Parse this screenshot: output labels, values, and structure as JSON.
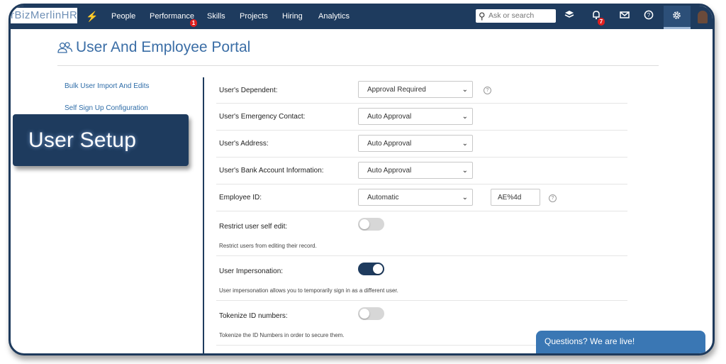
{
  "nav": {
    "logo": "rBizMerlinHR",
    "items": [
      "People",
      "Performance",
      "Skills",
      "Projects",
      "Hiring",
      "Analytics"
    ],
    "performance_badge": "1",
    "search_placeholder": "Ask or search",
    "notification_badge": "7",
    "icons": [
      "bolt-icon",
      "search-icon",
      "layers-icon",
      "bell-icon",
      "mail-icon",
      "help-icon",
      "gear-icon",
      "avatar"
    ]
  },
  "page": {
    "title": "User And Employee Portal"
  },
  "sidebar": {
    "links": [
      "Bulk User Import And Edits",
      "Self Sign Up Configuration"
    ],
    "callout": "User Setup"
  },
  "settings": {
    "dependent": {
      "label": "User's Dependent:",
      "value": "Approval Required"
    },
    "emergency": {
      "label": "User's Emergency Contact:",
      "value": "Auto Approval"
    },
    "address": {
      "label": "User's Address:",
      "value": "Auto Approval"
    },
    "bank": {
      "label": "User's Bank Account Information:",
      "value": "Auto Approval"
    },
    "employee_id": {
      "label": "Employee ID:",
      "value": "Automatic",
      "format": "AE%4d"
    },
    "restrict_edit": {
      "label": "Restrict user self edit:",
      "description": "Restrict users from editing their record.",
      "enabled": false
    },
    "impersonation": {
      "label": "User Impersonation:",
      "description": "User impersonation allows you to temporarily sign in as a different user.",
      "enabled": true
    },
    "tokenize": {
      "label": "Tokenize ID numbers:",
      "description": "Tokenize the ID Numbers in order to secure them.",
      "enabled": false
    }
  },
  "chat": {
    "label": "Questions? We are live!"
  },
  "colors": {
    "navy": "#1e3b5e",
    "link": "#2f6da8",
    "chat": "#3a77b4",
    "badge": "#e02020"
  }
}
